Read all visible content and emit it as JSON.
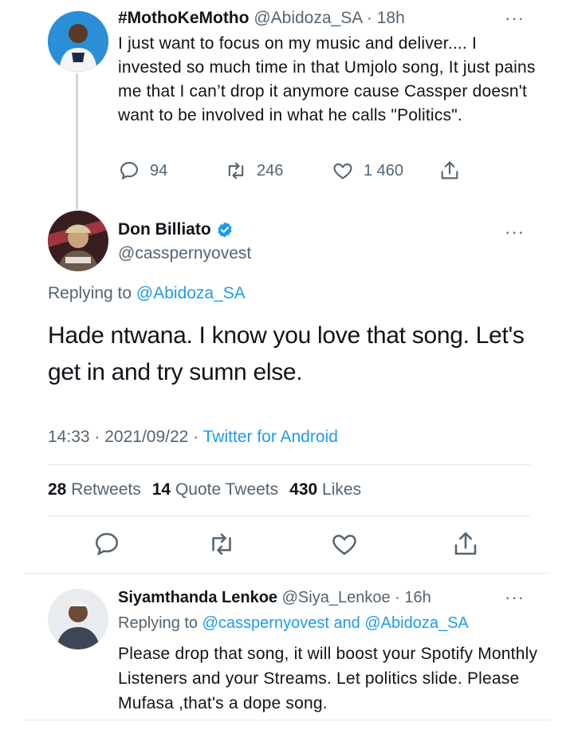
{
  "tweet1": {
    "display_name": "#MothoKeMotho",
    "handle": "@Abidoza_SA",
    "time": "18h",
    "separator": " · ",
    "text": "I just want to focus on my music and deliver.... I invested so much time in that Umjolo song, It just pains me that I can’t drop it anymore cause Cassper doesn't want to be involved in what he calls \"Politics\".",
    "replies": "94",
    "retweets": "246",
    "likes": "1 460"
  },
  "main_tweet": {
    "display_name": "Don Billiato",
    "handle": "@casspernyovest",
    "replying_prefix": "Replying to",
    "replying_to": "@Abidoza_SA",
    "text": "Hade ntwana. I know you love that song. Let's get in and try sumn else.",
    "time": "14:33",
    "date": "2021/09/22",
    "source": "Twitter for Android",
    "dot": " · ",
    "retweets_count": "28",
    "retweets_label": "Retweets",
    "quotes_count": "14",
    "quotes_label": "Quote Tweets",
    "likes_count": "430",
    "likes_label": "Likes",
    "verified_icon": "verified-badge-icon"
  },
  "reply": {
    "display_name": "Siyamthanda Lenkoe",
    "handle": "@Siya_Lenkoe",
    "time": "16h",
    "separator": " · ",
    "replying_prefix": "Replying to",
    "replying_to": "@casspernyovest and @Abidoza_SA",
    "text": "Please drop that song, it will boost your Spotify Monthly Listeners and your Streams. Let politics slide. Please Mufasa ,that's a dope song."
  },
  "more_icon_text": "···",
  "colors": {
    "accent": "#1d9bf0",
    "muted": "#536471",
    "text": "#0f1419",
    "divider": "#e1e8ed"
  }
}
